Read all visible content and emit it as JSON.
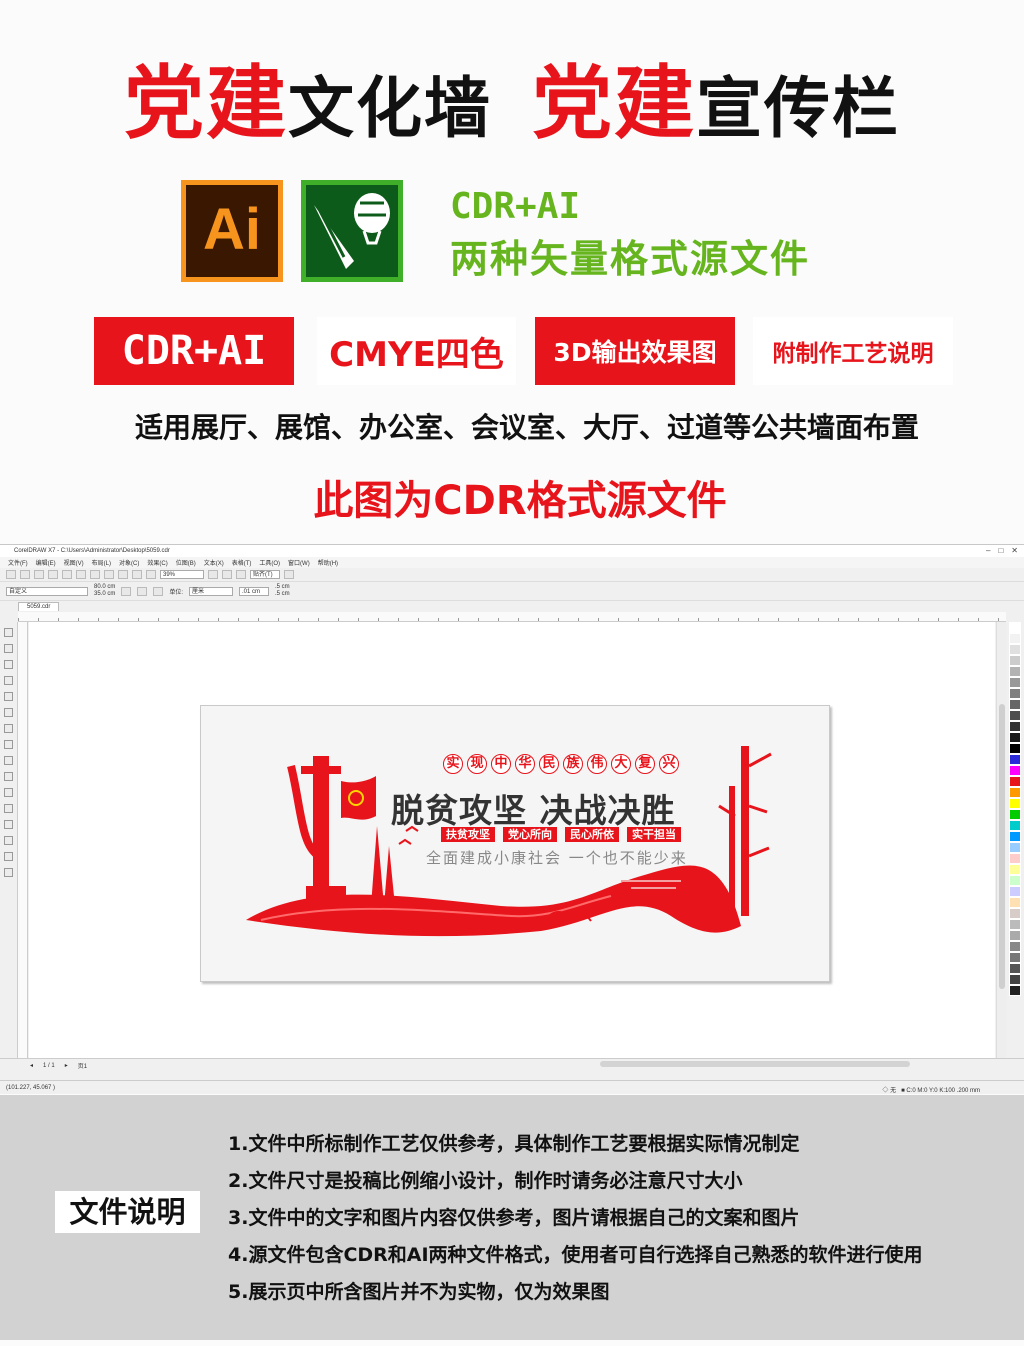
{
  "header": {
    "title_part1_red": "党建",
    "title_part1_black": "文化墙",
    "title_part2_red": "党建",
    "title_part2_black": "宣传栏",
    "ai_icon_label": "Ai",
    "format_line1": "CDR+AI",
    "format_line2": "两种矢量格式源文件"
  },
  "badges": [
    "CDR+AI",
    "CMYE四色",
    "3D输出效果图",
    "附制作工艺说明"
  ],
  "usage_text": "适用展厅、展馆、办公室、会议室、大厅、过道等公共墙面布置",
  "cdr_note": "此图为CDR格式源文件",
  "app": {
    "title": "CorelDRAW X7 - C:\\Users\\Administrator\\Desktop\\5059.cdr",
    "menu": [
      "文件(F)",
      "编辑(E)",
      "视图(V)",
      "布局(L)",
      "对象(C)",
      "效果(C)",
      "位图(B)",
      "文本(X)",
      "表格(T)",
      "工具(O)",
      "窗口(W)",
      "帮助(H)"
    ],
    "zoom": "39%",
    "snap": "贴齐(T)",
    "page_preset": "自定义",
    "width": "80.0 cm",
    "height": "35.0 cm",
    "unit_label": "单位:",
    "unit": "厘米",
    "nudge": ".01 cm",
    "dup_x": ".5 cm",
    "dup_y": ".5 cm",
    "doc_tab": "5059.cdr",
    "page_count": "1 / 1",
    "page_tab": "页1",
    "cursor_pos": "(101.227, 45.067 )",
    "fill_label": "无",
    "color_readout": "C:0 M:0 Y:0 K:100  .200 mm",
    "palette_colors": [
      "#ffffff",
      "#f2f2f2",
      "#e0e0e0",
      "#cccccc",
      "#b3b3b3",
      "#999999",
      "#808080",
      "#666666",
      "#4d4d4d",
      "#333333",
      "#1a1a1a",
      "#000000",
      "#2b2bd9",
      "#ff00ff",
      "#e8141b",
      "#ff9900",
      "#ffff00",
      "#00cc00",
      "#00cccc",
      "#0099ff",
      "#99ccff",
      "#ffcccc",
      "#ffff99",
      "#ccffcc",
      "#ccccff",
      "#ffe0b2",
      "#d7ccc8",
      "#bbbbbb",
      "#aaaaaa",
      "#888888",
      "#777777",
      "#555555",
      "#444444",
      "#222222"
    ]
  },
  "design": {
    "top_chars": [
      "实",
      "现",
      "中",
      "华",
      "民",
      "族",
      "伟",
      "大",
      "复",
      "兴"
    ],
    "main_slogan": "脱贫攻坚  决战决胜",
    "tags": [
      "扶贫攻坚",
      "党心所向",
      "民心所依",
      "实干担当"
    ],
    "sub_slogan": "全面建成小康社会  一个也不能少来"
  },
  "notes": {
    "label": "文件说明",
    "items": [
      "1.文件中所标制作工艺仅供参考，具体制作工艺要根据实际情况制定",
      "2.文件尺寸是投稿比例缩小设计，制作时请务必注意尺寸大小",
      "3.文件中的文字和图片内容仅供参考，图片请根据自己的文案和图片",
      "4.源文件包含CDR和AI两种文件格式，使用者可自行选择自己熟悉的软件进行使用",
      "5.展示页中所含图片并不为实物，仅为效果图"
    ]
  },
  "colors": {
    "accent_red": "#e8141b",
    "ai_orange": "#f7941d",
    "cdr_green": "#3fae29",
    "format_green": "#66b51f"
  }
}
